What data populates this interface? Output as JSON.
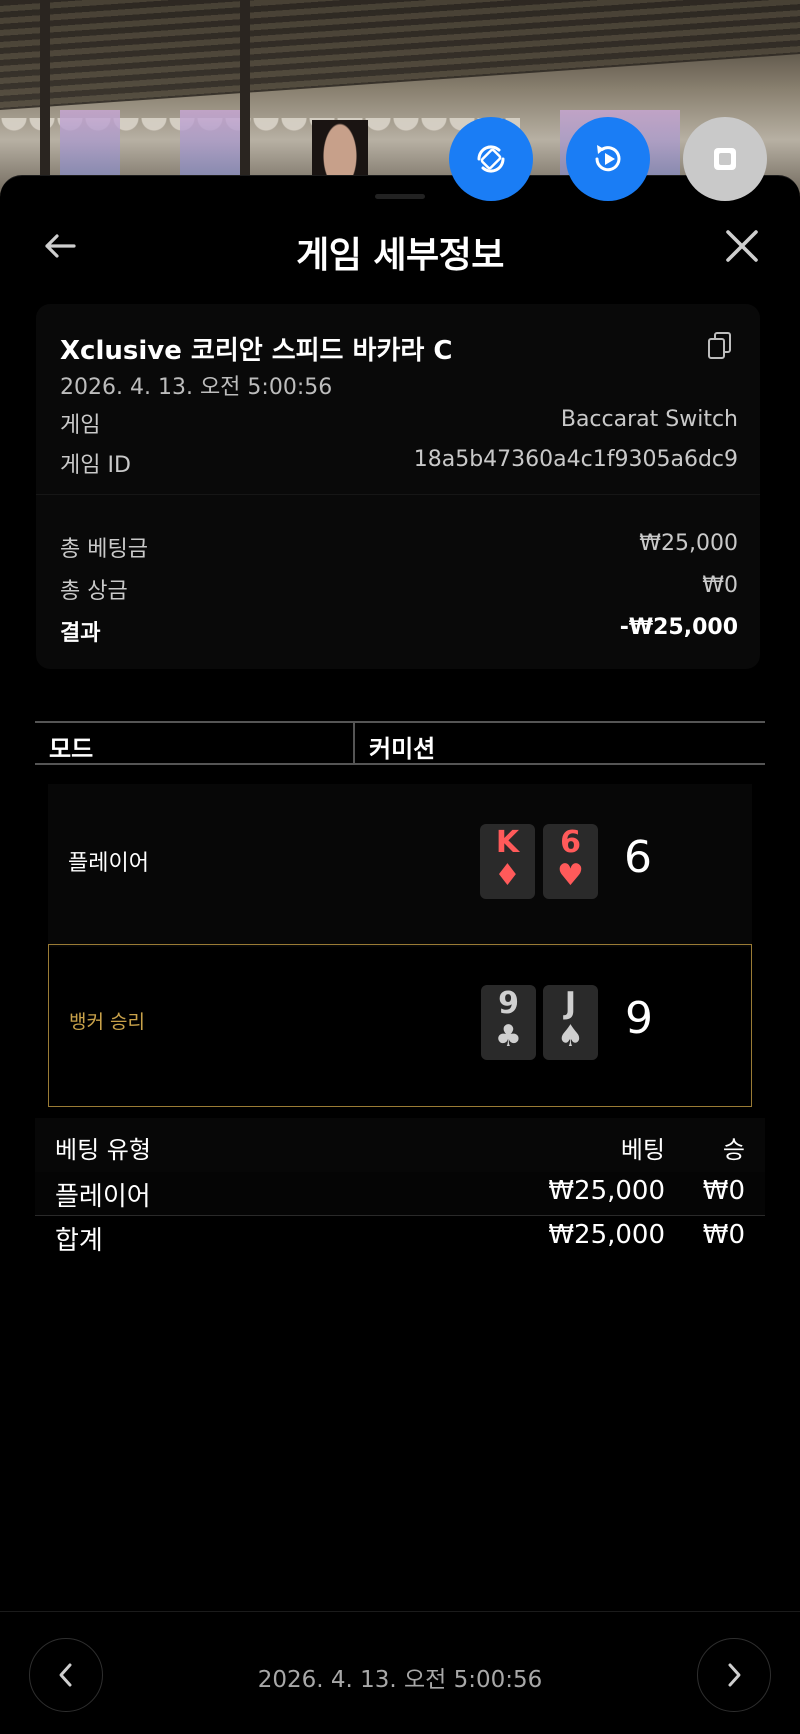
{
  "header": {
    "title": "게임 세부정보"
  },
  "summary": {
    "game_name": "Xclusive 코리안 스피드 바카라 C",
    "date": "2026. 4. 13. 오전 5:00:56",
    "game_label": "게임",
    "game_value": "Baccarat Switch",
    "game_id_label": "게임 ID",
    "game_id_value": "18a5b47360a4c1f9305a6dc9",
    "total_bet_label": "총 베팅금",
    "total_bet_value": "₩25,000",
    "total_win_label": "총 상금",
    "total_win_value": "₩0",
    "result_label": "결과",
    "result_value": "-₩25,000"
  },
  "mode_table": {
    "col1": "모드",
    "col2": "커미션"
  },
  "hands": {
    "player": {
      "label": "플레이어",
      "cards": [
        {
          "rank": "K",
          "suit": "♦"
        },
        {
          "rank": "6",
          "suit": "♥"
        }
      ],
      "score": "6"
    },
    "banker": {
      "label": "뱅커 승리",
      "cards": [
        {
          "rank": "9",
          "suit": "♣"
        },
        {
          "rank": "J",
          "suit": "♠"
        }
      ],
      "score": "9"
    }
  },
  "bets": {
    "headers": {
      "type": "베팅 유형",
      "bet": "베팅",
      "win": "승"
    },
    "rows": [
      {
        "type": "플레이어",
        "bet": "₩25,000",
        "win": "₩0"
      }
    ],
    "total": {
      "type": "합계",
      "bet": "₩25,000",
      "win": "₩0"
    }
  },
  "footer": {
    "date": "2026. 4. 13. 오전 5:00:56"
  },
  "colors": {
    "fab_blue": "#1a7df5",
    "banker_accent": "#c9a24a",
    "red_suit": "#ff5a5a"
  },
  "icons": {
    "fab1": "rotate-phone-icon",
    "fab2": "replay-icon",
    "fab3": "stop-icon",
    "back": "arrow-left-icon",
    "close": "close-icon",
    "copy": "copy-icon",
    "prev": "chevron-left-icon",
    "next": "chevron-right-icon"
  }
}
